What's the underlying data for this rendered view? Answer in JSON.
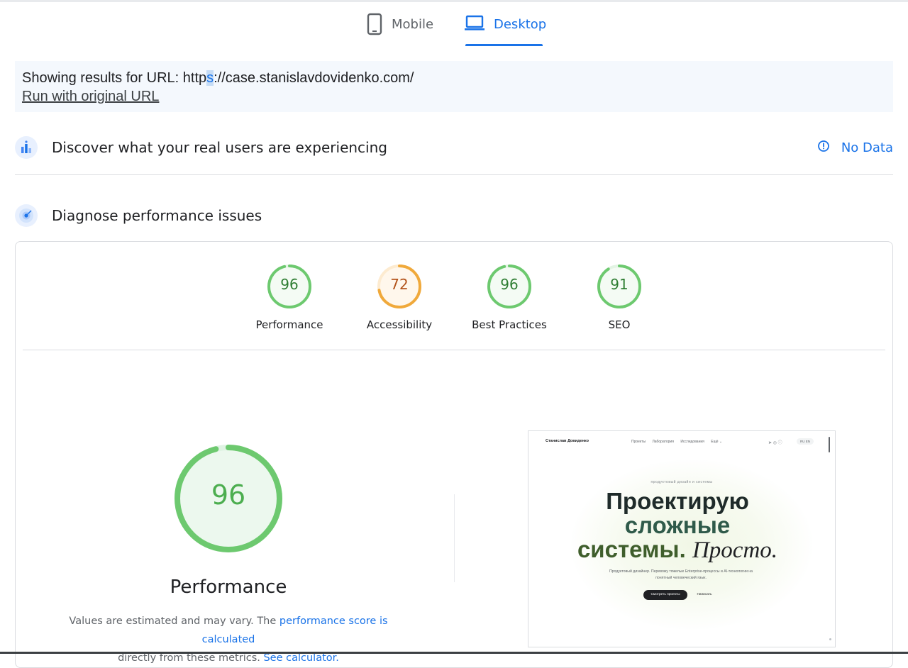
{
  "tabs": {
    "mobile": {
      "label": "Mobile",
      "icon": "smartphone-icon"
    },
    "desktop": {
      "label": "Desktop",
      "icon": "laptop-icon",
      "active": true
    }
  },
  "banner": {
    "prefix": "Showing results for URL: http",
    "highlight": "s",
    "suffix": "://case.stanislavdovidenko.com/",
    "run_original": "Run with original URL"
  },
  "field_data": {
    "title": "Discover what your real users are experiencing",
    "status_label": "No Data",
    "icon": "bar-chart-icon",
    "status_icon": "info-icon"
  },
  "diagnose": {
    "title": "Diagnose performance issues",
    "icon": "target-icon"
  },
  "categories": [
    {
      "label": "Performance",
      "score": "96",
      "value": 96,
      "color": "#0cce6b"
    },
    {
      "label": "Accessibility",
      "score": "72",
      "value": 72,
      "color": "#ffa400"
    },
    {
      "label": "Best Practices",
      "score": "96",
      "value": 96,
      "color": "#0cce6b"
    },
    {
      "label": "SEO",
      "score": "91",
      "value": 91,
      "color": "#0cce6b"
    }
  ],
  "performance": {
    "score": "96",
    "value": 96,
    "title": "Performance",
    "note_part1": "Values are estimated and may vary. The ",
    "note_link1": "performance score is calculated",
    "note_part2": " directly from these metrics. ",
    "note_link2": "See calculator."
  },
  "screenshot": {
    "site_name": "Станислав Довиденко",
    "nav": [
      "Проекты",
      "Лаборатория",
      "Исследования",
      "Ещё ⌄"
    ],
    "lang": "RU EN",
    "eyebrow": "продуктовый дизайн и системы",
    "headline_1": "Проектирую",
    "headline_2": "сложные",
    "headline_3": "системы.",
    "headline_serif": "Просто.",
    "description": "Продуктовый дизайнер. Перевожу тяжелые Enterprise-процессы и AI-технологии на понятный человеческий язык.",
    "primary_button": "Смотреть проекты",
    "secondary_button": "Написать"
  },
  "colors": {
    "accent": "#1a73e8",
    "pass": "#0cce6b",
    "average": "#ffa400"
  }
}
